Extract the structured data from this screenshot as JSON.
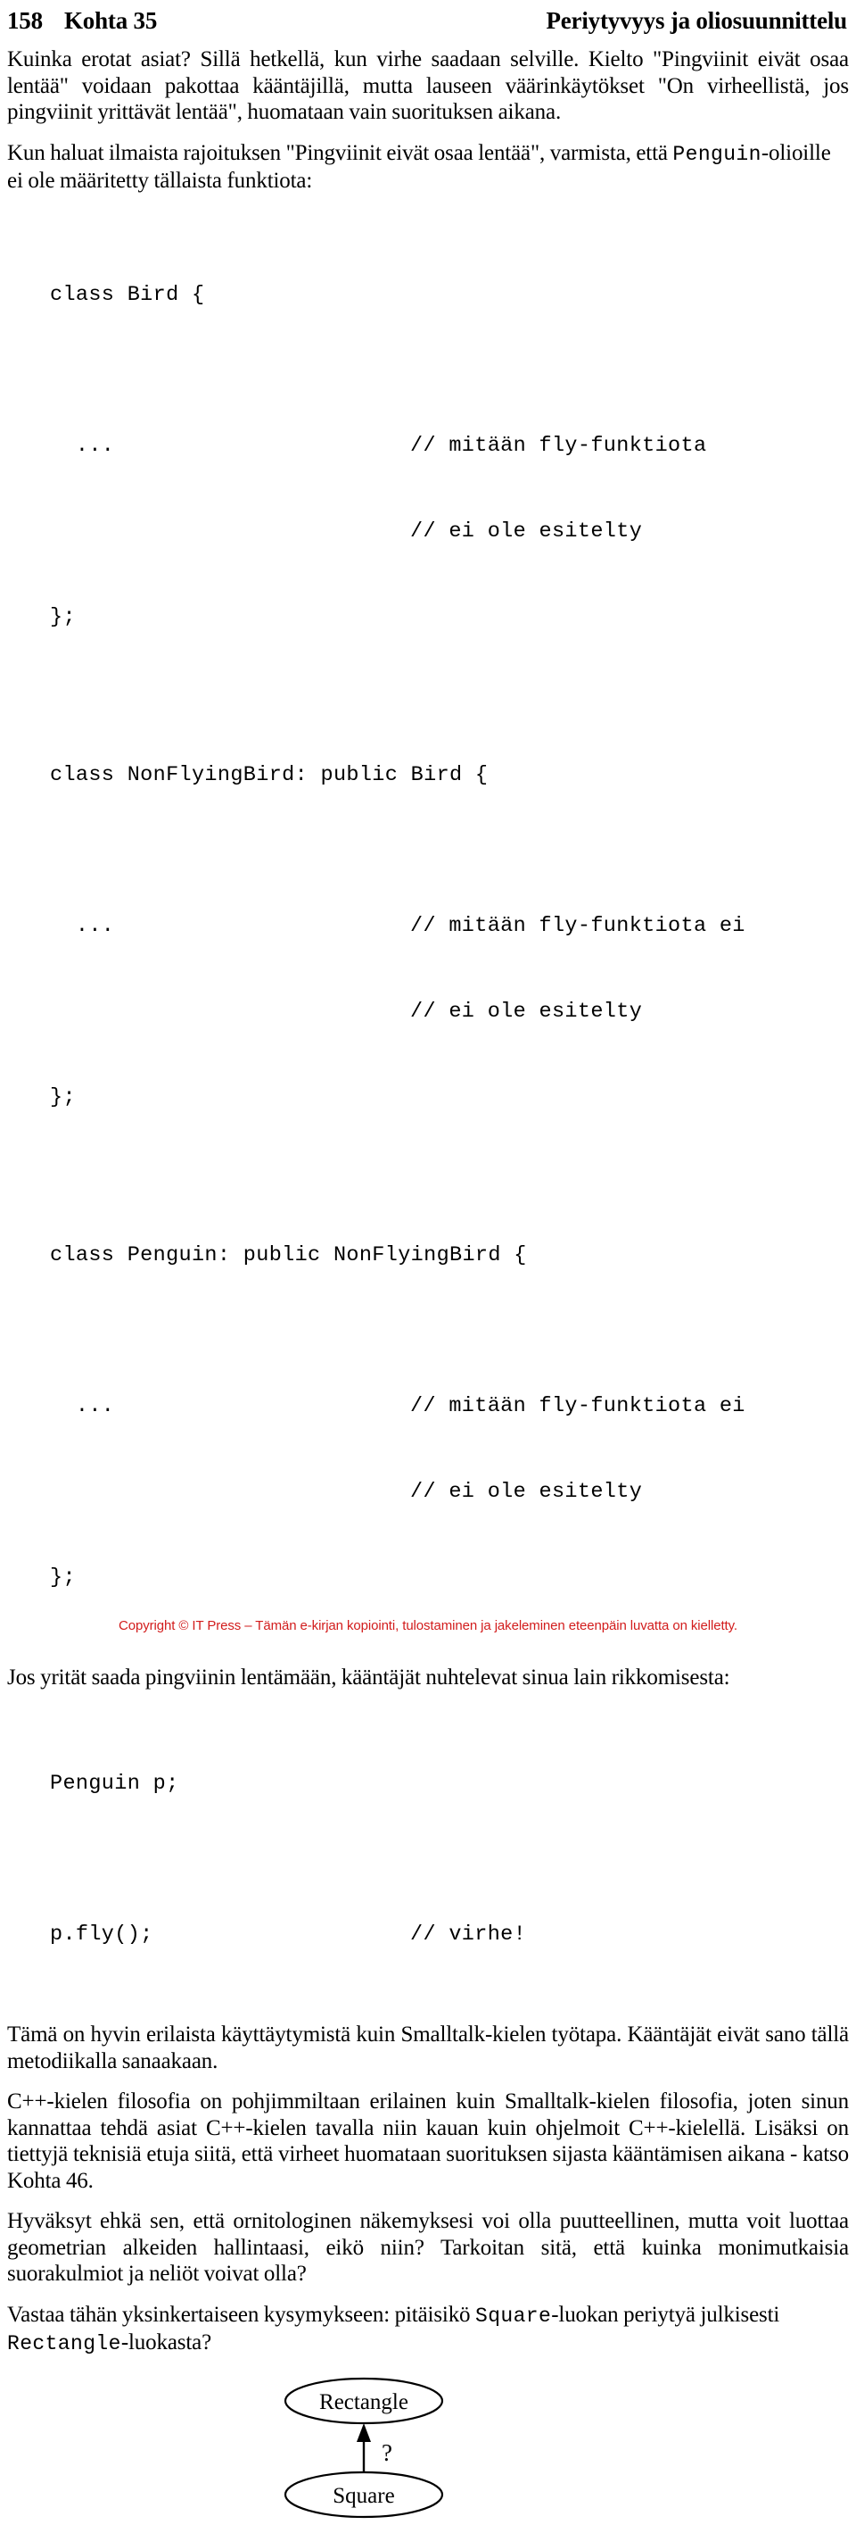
{
  "header": {
    "folio": "158",
    "chapter": "Kohta 35",
    "book_title": "Periytyvyys ja oliosuunnittelu"
  },
  "paragraphs": {
    "p1": "Kuinka erotat asiat? Sillä hetkellä, kun virhe saadaan selville. Kielto \"Pingviinit eivät osaa lentää\" voidaan pakottaa kääntäjillä, mutta lauseen väärinkäytökset \"On virheellistä, jos pingviinit yrittävät lentää\", huomataan vain suorituksen aikana.",
    "p2_a": "Kun haluat ilmaista rajoituksen \"Pingviinit eivät osaa lentää\", varmista, että ",
    "p2_code": "Penguin",
    "p2_b": "-olioille ei ole määritetty tällaista funktiota:",
    "p3": "Jos yrität saada pingviinin lentämään, kääntäjät nuhtelevat sinua lain rikkomisesta:",
    "p4": "Tämä on hyvin erilaista käyttäytymistä kuin Smalltalk-kielen työtapa. Kääntäjät eivät sano tällä metodiikalla sanaakaan.",
    "p5": "C++-kielen filosofia on pohjimmiltaan erilainen kuin Smalltalk-kielen filosofia, joten sinun kannattaa tehdä asiat C++-kielen tavalla niin kauan kuin ohjelmoit C++-kielellä. Lisäksi on tiettyjä teknisiä etuja siitä, että virheet huomataan suorituksen sijasta kääntämisen aikana - katso Kohta 46.",
    "p6": "Hyväksyt ehkä sen, että ornitologinen näkemyksesi voi olla puutteellinen, mutta voit luottaa geometrian alkeiden hallintaasi, eikö niin? Tarkoitan sitä, että kuinka monimutkaisia suorakulmiot ja neliöt voivat olla?",
    "p7_a": "Vastaa tähän yksinkertaiseen kysymykseen: pitäisikö ",
    "p7_code1": "Square",
    "p7_b": "-luokan periytyä julkisesti ",
    "p7_code2": "Rectangle",
    "p7_c": "-luokasta?"
  },
  "code_block_1": {
    "l1": "class Bird {",
    "l2_code": "  ...",
    "l2_comment": "// mitään fly-funktiota",
    "l3_comment": "// ei ole esitelty",
    "l4": "};"
  },
  "code_block_2": {
    "l1": "class NonFlyingBird: public Bird {",
    "l2_code": "  ...",
    "l2_comment": "// mitään fly-funktiota ei",
    "l3_comment": "// ei ole esitelty",
    "l4": "};"
  },
  "code_block_3": {
    "l1": "class Penguin: public NonFlyingBird {",
    "l2_code": "  ...",
    "l2_comment": "// mitään fly-funktiota ei",
    "l3_comment": "// ei ole esitelty",
    "l4": "};"
  },
  "code_block_4": {
    "l1": "Penguin p;",
    "l2_code": "p.fly();",
    "l2_comment": "// virhe!"
  },
  "diagram": {
    "parent_node": "Rectangle",
    "child_node": "Square",
    "edge_label": "?"
  },
  "footer": {
    "text": "Copyright © IT Press – Tämän e-kirjan kopiointi, tulostaminen ja jakeleminen eteenpäin luvatta on kielletty.",
    "color": "#d21c1c"
  }
}
